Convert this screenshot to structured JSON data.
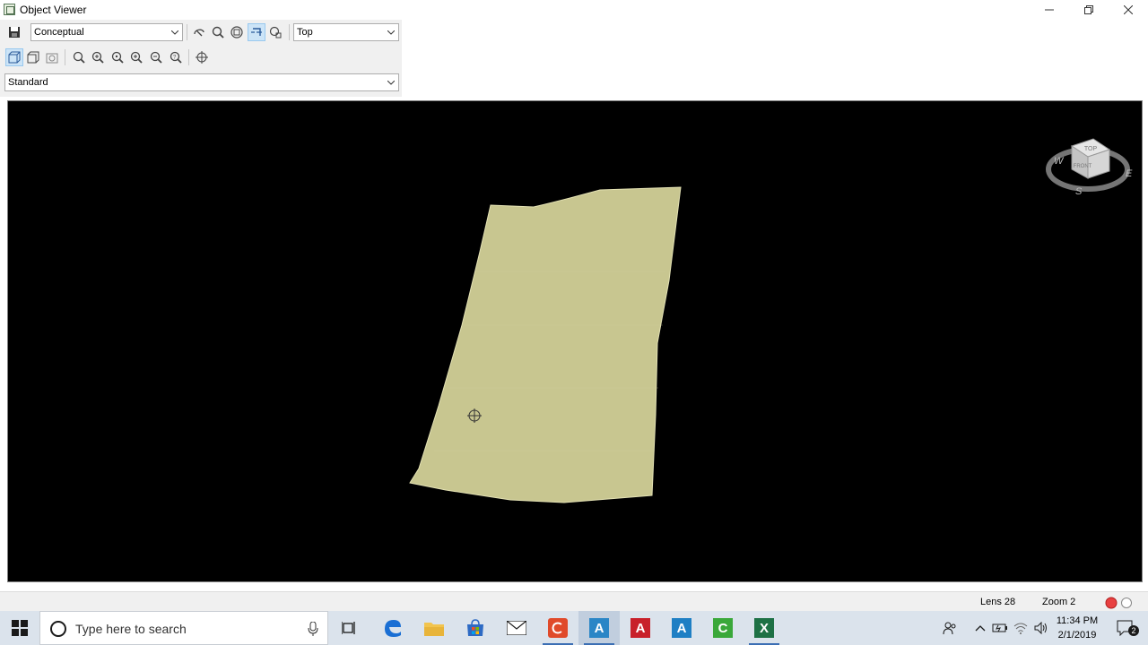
{
  "window": {
    "title": "Object Viewer",
    "minimize": "—",
    "maximize": "❐",
    "close": "✕"
  },
  "toolbar": {
    "visual_style": "Conceptual",
    "view": "Top",
    "ucs": "Standard"
  },
  "viewcube": {
    "top": "TOP",
    "front": "FRONT",
    "north": "W",
    "east": "E",
    "south": "S"
  },
  "status": {
    "lens": "Lens 28",
    "zoom": "Zoom 2"
  },
  "taskbar": {
    "search_placeholder": "Type here to search",
    "time": "11:34 PM",
    "date": "2/1/2019",
    "notification_count": "2"
  },
  "colors": {
    "surface": "#c8c690",
    "viewport_bg": "#000000",
    "taskbar_bg": "#dbe3ec",
    "accent": "#3c6fb4"
  },
  "icons": [
    "save-icon",
    "orbit-icon",
    "zoom-icon",
    "zoom-extents-icon",
    "pan-icon",
    "view-cube-icon",
    "windows-start-icon",
    "cortana-icon",
    "microphone-icon",
    "task-view-icon",
    "edge-icon",
    "file-explorer-icon",
    "store-icon",
    "mail-icon",
    "autocad-icon",
    "excel-icon",
    "network-icon",
    "volume-icon",
    "notification-icon"
  ]
}
